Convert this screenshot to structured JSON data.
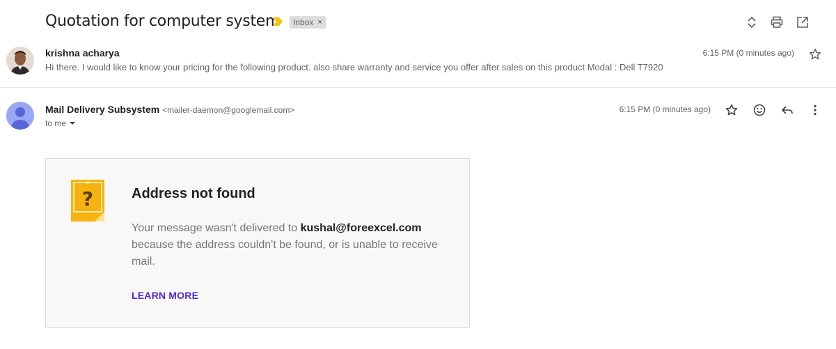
{
  "subject": {
    "title": "Quotation for computer system",
    "label": "Inbox",
    "label_close": "×"
  },
  "toolbar": {
    "icons": [
      "expand-collapse-icon",
      "print-icon",
      "open-in-new-window-icon"
    ]
  },
  "message1": {
    "sender": "krishna acharya",
    "snippet": "Hi there. I would like to know your pricing for the following product. also share warranty and service you offer after sales on this product Modal : Dell T7920",
    "time": "6:15 PM (0 minutes ago)"
  },
  "message2": {
    "sender_name": "Mail Delivery Subsystem",
    "sender_email": "<mailer-daemon@googlemail.com>",
    "recipient": "to me",
    "time": "6:15 PM (0 minutes ago)"
  },
  "bounce_card": {
    "title": "Address not found",
    "body_prefix": "Your message wasn't delivered to ",
    "address": "kushal@foreexcel.com",
    "body_suffix": " because the address couldn't be found, or is unable to receive mail.",
    "link": "LEARN MORE"
  },
  "colors": {
    "importance_marker": "#f4c20d",
    "avatar_default": "#9aa7f5",
    "link": "#4d2ad4",
    "warning_icon": "#f6b20f"
  }
}
